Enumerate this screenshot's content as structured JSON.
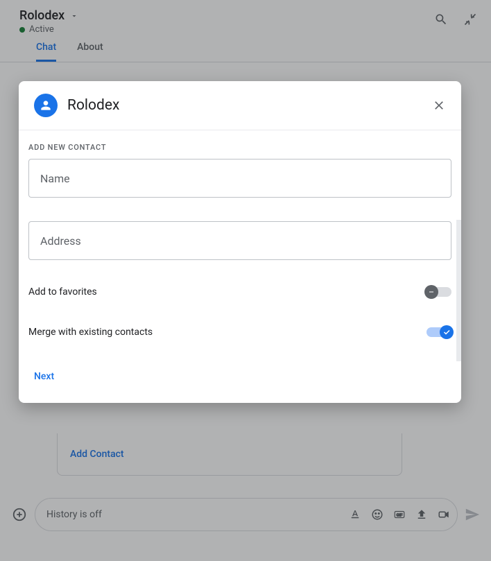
{
  "header": {
    "title": "Rolodex",
    "status": "Active"
  },
  "tabs": [
    {
      "label": "Chat",
      "active": true
    },
    {
      "label": "About",
      "active": false
    }
  ],
  "bg_card": {
    "action": "Add Contact"
  },
  "compose": {
    "placeholder": "History is off"
  },
  "dialog": {
    "title": "Rolodex",
    "section_label": "ADD NEW CONTACT",
    "fields": {
      "name_placeholder": "Name",
      "address_placeholder": "Address"
    },
    "toggles": {
      "favorites_label": "Add to favorites",
      "favorites_on": false,
      "merge_label": "Merge with existing contacts",
      "merge_on": true
    },
    "next_label": "Next"
  }
}
